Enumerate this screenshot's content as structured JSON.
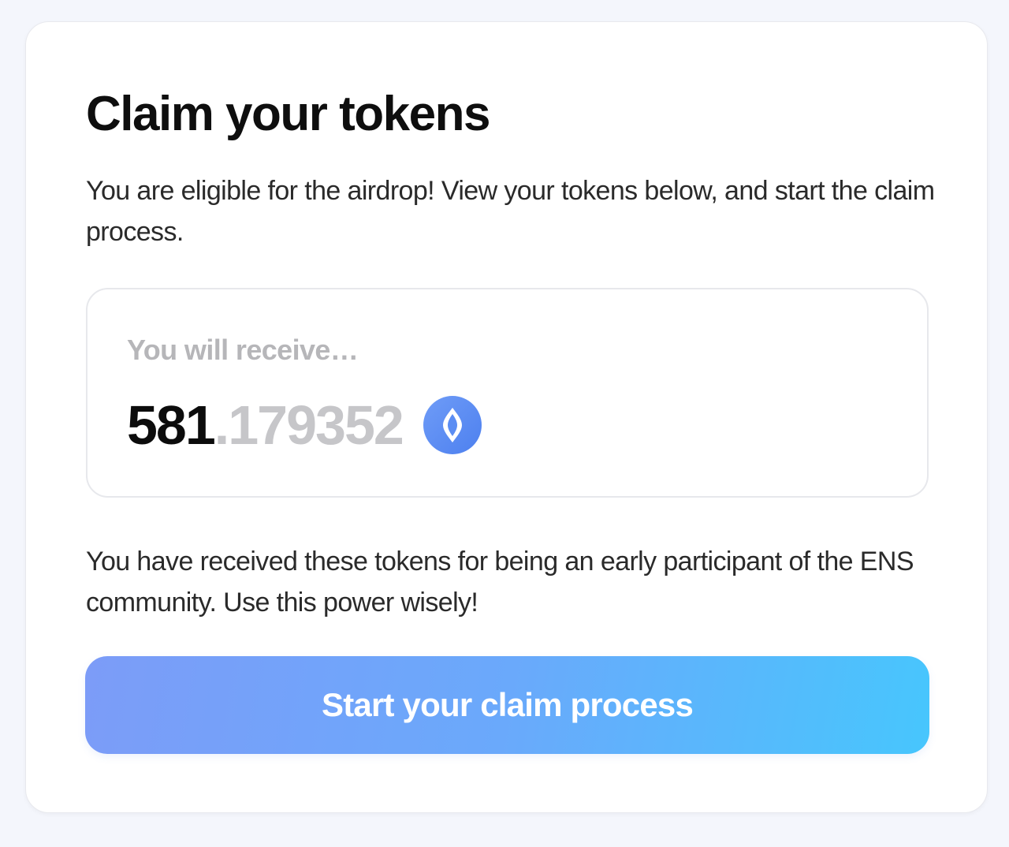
{
  "card": {
    "title": "Claim your tokens",
    "intro": "You are eligible for the airdrop! View your tokens below, and start the claim process.",
    "receive": {
      "label": "You will receive…",
      "amount_integer": "581",
      "amount_decimal": ".179352",
      "token_icon": "ens-token-icon"
    },
    "outro": "You have received these tokens for being an early participant of the ENS community. Use this power wisely!",
    "button_label": "Start your claim process"
  },
  "colors": {
    "button_gradient_start": "#7c9cf8",
    "button_gradient_end": "#47c6fd",
    "ens_icon": "#5b8df3"
  }
}
